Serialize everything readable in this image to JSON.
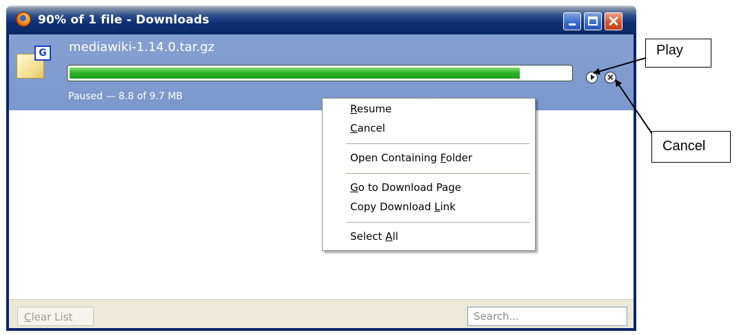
{
  "window": {
    "title": "90% of 1 file - Downloads",
    "controls": [
      "minimize",
      "maximize",
      "close"
    ]
  },
  "download": {
    "filename": "mediawiki-1.14.0.tar.gz",
    "status": "Paused — 8.8 of 9.7 MB",
    "progress_fraction": 0.9,
    "icon_badge": "G"
  },
  "bottom_bar": {
    "clear_button": "Clear List",
    "search_placeholder": "Search..."
  },
  "context_menu": {
    "items": [
      {
        "label": "Resume",
        "accel": "R"
      },
      {
        "label": "Cancel",
        "accel": "C"
      },
      {
        "label": "Open Containing Folder",
        "accel": "F"
      },
      {
        "label": "Go to Download Page",
        "accel": "G"
      },
      {
        "label": "Copy Download Link",
        "accel": "L"
      },
      {
        "label": "Select All",
        "accel": "A"
      }
    ]
  },
  "callouts": {
    "play": "Play",
    "cancel": "Cancel"
  },
  "colors": {
    "titlebar": "#0b2a66",
    "selected_row": "#7b97cc",
    "progress": "#2fb52a",
    "close_button": "#d9522b"
  }
}
